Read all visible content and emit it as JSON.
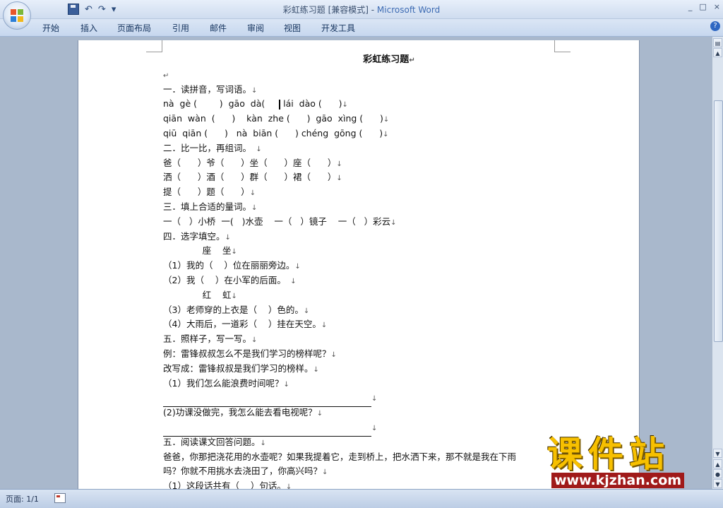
{
  "window": {
    "doc_name": "彩虹练习题 [兼容模式] - ",
    "app_name": "Microsoft Word",
    "minimize": "_",
    "restore": "□",
    "close": "×"
  },
  "quick_access": {
    "undo": "↶",
    "redo": "↷",
    "customize": "▾"
  },
  "ribbon": {
    "tabs": [
      "开始",
      "插入",
      "页面布局",
      "引用",
      "邮件",
      "审阅",
      "视图",
      "开发工具"
    ],
    "help": "?"
  },
  "document": {
    "title": "彩虹练习题",
    "lines": [
      "",
      "一．读拼音，写词语。",
      "nà  gè (        )  gāo  dà(     ",
      "qiān  wàn  (      )    kàn  zhe (      )  gāo  xìng (      )",
      "qiū  qiān (      )   nà  biān (      ) chéng  gōng (      )",
      "二．比一比，再组词。",
      "爸（      ）爷（      ）坐（      ）座（      ）",
      "洒（      ）酒（      ）群（      ）裙（      ）",
      "提（      ）题（      ）",
      "三．填上合适的量词。",
      "一（   ）小桥  一(   )水壶    一（   ）镜子    一（   ）彩云",
      "四．选字填空。",
      "              座    坐",
      "（1）我的（    ）位在丽丽旁边。",
      "（2）我（    ）在小军的后面。",
      "              红    虹",
      "（3）老师穿的上衣是（    ）色的。",
      "（4）大雨后，一道彩（    ）挂在天空。",
      "五．照样子，写一写。",
      "例：雷锋叔叔怎么不是我们学习的榜样呢？",
      "改写成：雷锋叔叔是我们学习的榜样。",
      "（1）我们怎么能浪费时间呢？",
      "",
      "(2)功课没做完，我怎么能去看电视呢？",
      "",
      "五．阅读课文回答问题。",
      "爸爸，你那把浇花用的水壶呢？如果我提着它，走到桥上，把水洒下来，那不就是我在下雨",
      "吗？你就不用挑水去浇田了，你高兴吗？",
      "（1）这段话共有（    ）句话。"
    ],
    "line1_tail": " lái  dào (      )"
  },
  "status": {
    "page": "页面: 1/1"
  },
  "watermark": {
    "text": "课件站",
    "url": "www.kjzhan.com"
  },
  "colors": {
    "title_accent": "#3d6bb3",
    "watermark_yellow": "#f7c000",
    "watermark_red": "#a01a1a"
  }
}
